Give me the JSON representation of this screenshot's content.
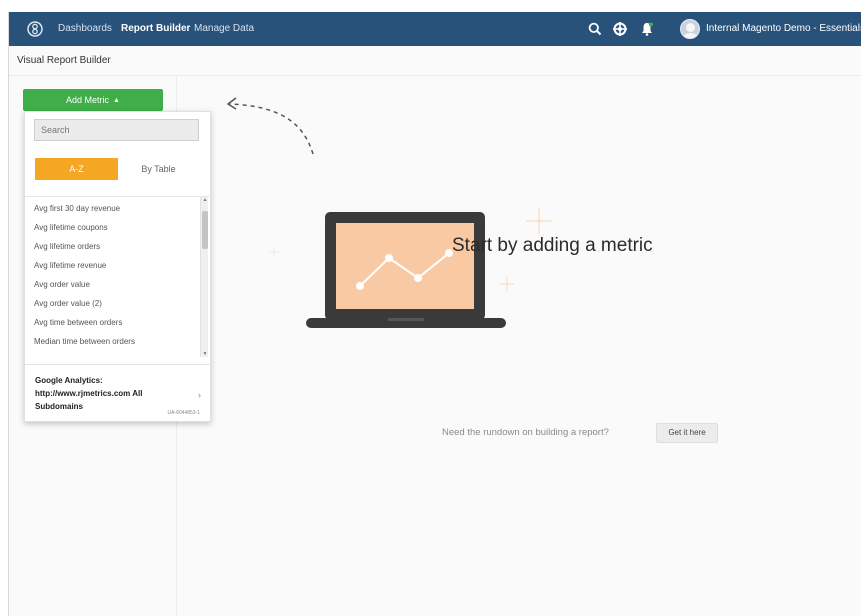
{
  "nav": {
    "links": [
      "Dashboards",
      "Report Builder",
      "Manage Data"
    ],
    "active": "Report Builder",
    "account": "Internal Magento Demo - Essentials",
    "icons": [
      "search-icon",
      "settings-icon",
      "notification-bell-icon",
      "avatar"
    ]
  },
  "page": {
    "title": "Visual Report Builder"
  },
  "metric_picker": {
    "button_label": "Add Metric",
    "search_placeholder": "Search",
    "segments": [
      "A-Z",
      "By Table"
    ],
    "active_segment": "A-Z",
    "items": [
      "Avg first 30 day revenue",
      "Avg lifetime coupons",
      "Avg lifetime orders",
      "Avg lifetime revenue",
      "Avg order value",
      "Avg order value (2)",
      "Avg time between orders",
      "Median time between orders"
    ],
    "source": {
      "name": "Google Analytics: http://www.rjmetrics.com All Subdomains",
      "id": "UA-6044853-1"
    }
  },
  "empty_state": {
    "title": "Start by adding a metric",
    "rundown_text": "Need the rundown on building a report?",
    "cta_label": "Get it here"
  },
  "colors": {
    "nav_bg": "#29527a",
    "add_metric_green": "#3fae49",
    "segment_active": "#f5a623",
    "illustration_screen": "#f9c9a4",
    "illustration_frame": "#3a3a3a"
  }
}
